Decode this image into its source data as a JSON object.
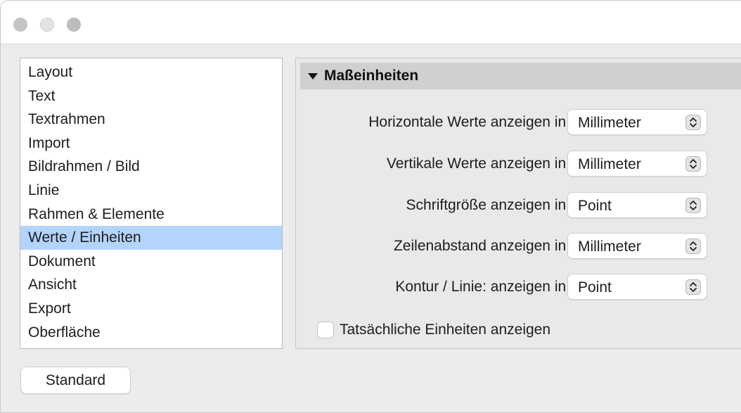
{
  "window": {
    "traffic_lights": [
      "close",
      "minimize",
      "zoom"
    ]
  },
  "sidebar": {
    "items": [
      {
        "label": "Layout"
      },
      {
        "label": "Text"
      },
      {
        "label": "Textrahmen"
      },
      {
        "label": "Import"
      },
      {
        "label": "Bildrahmen / Bild"
      },
      {
        "label": "Linie"
      },
      {
        "label": "Rahmen & Elemente"
      },
      {
        "label": "Werte / Einheiten",
        "selected": true
      },
      {
        "label": "Dokument"
      },
      {
        "label": "Ansicht"
      },
      {
        "label": "Export"
      },
      {
        "label": "Oberfläche"
      }
    ],
    "selected_color": "#b3d4fc"
  },
  "section": {
    "title": "Maßeinheiten",
    "icon": "disclosure-triangle-down-icon"
  },
  "rows": [
    {
      "label": "Horizontale Werte anzeigen in:",
      "value": "Millimeter"
    },
    {
      "label": "Vertikale Werte anzeigen in:",
      "value": "Millimeter"
    },
    {
      "label": "Schriftgröße anzeigen in:",
      "value": "Point"
    },
    {
      "label": "Zeilenabstand anzeigen in:",
      "value": "Millimeter"
    },
    {
      "label": "Kontur / Linie: anzeigen in:",
      "value": "Point"
    }
  ],
  "checkbox": {
    "label": "Tatsächliche Einheiten anzeigen",
    "checked": false
  },
  "footer": {
    "standard_label": "Standard"
  }
}
